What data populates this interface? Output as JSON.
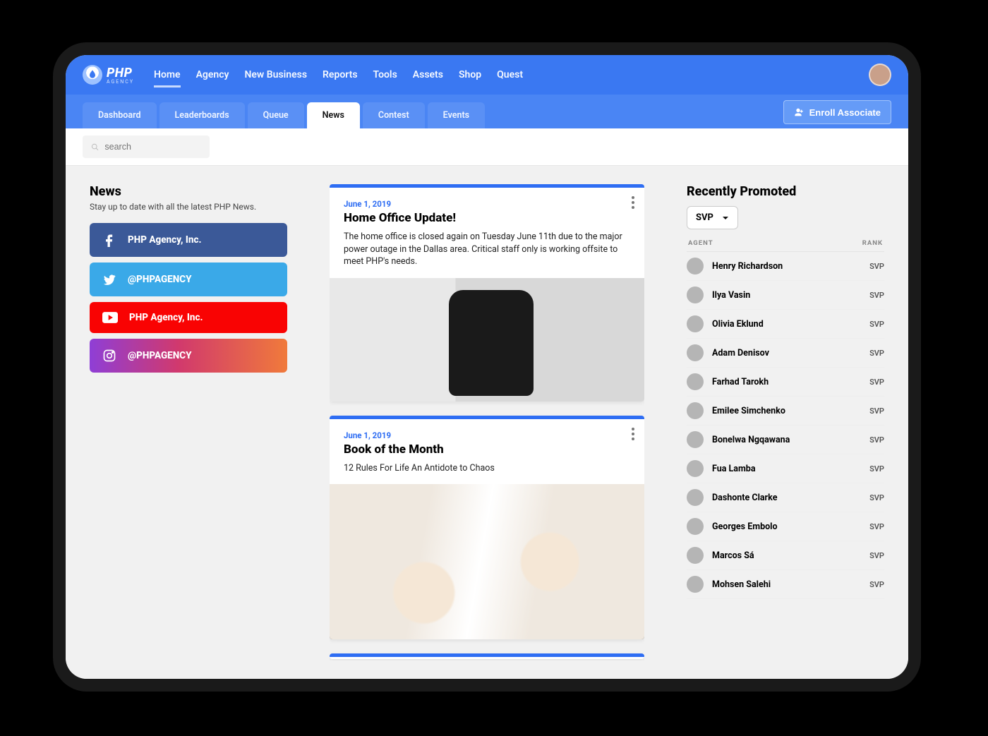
{
  "brand": {
    "name": "PHP",
    "sub": "AGENCY"
  },
  "mainnav": {
    "items": [
      "Home",
      "Agency",
      "New Business",
      "Reports",
      "Tools",
      "Assets",
      "Shop",
      "Quest"
    ],
    "active": 0
  },
  "subnav": {
    "items": [
      "Dashboard",
      "Leaderboards",
      "Queue",
      "News",
      "Contest",
      "Events"
    ],
    "active": 3
  },
  "enroll_label": "Enroll Associate",
  "search": {
    "placeholder": "search"
  },
  "left": {
    "heading": "News",
    "subtitle": "Stay up to date with all the latest PHP News.",
    "social": [
      {
        "network": "facebook",
        "label": "PHP Agency, Inc."
      },
      {
        "network": "twitter",
        "label": "@PHPAGENCY"
      },
      {
        "network": "youtube",
        "label": "PHP Agency, Inc."
      },
      {
        "network": "instagram",
        "label": "@PHPAGENCY"
      }
    ]
  },
  "feed": [
    {
      "date": "June 1, 2019",
      "title": "Home Office Update!",
      "desc": "The home office is closed again on Tuesday June 11th due to the major power outage in the Dallas area. Critical staff only is working offsite to meet PHP's needs."
    },
    {
      "date": "June 1, 2019",
      "title": "Book of the Month",
      "desc": "12 Rules For Life An Antidote to Chaos"
    }
  ],
  "right": {
    "heading": "Recently Promoted",
    "selected_rank": "SVP",
    "columns": {
      "agent": "AGENT",
      "rank": "RANK"
    },
    "agents": [
      {
        "name": "Henry Richardson",
        "rank": "SVP"
      },
      {
        "name": "Ilya Vasin",
        "rank": "SVP"
      },
      {
        "name": "Olivia Eklund",
        "rank": "SVP"
      },
      {
        "name": "Adam Denisov",
        "rank": "SVP"
      },
      {
        "name": "Farhad Tarokh",
        "rank": "SVP"
      },
      {
        "name": "Emilee Simchenko",
        "rank": "SVP"
      },
      {
        "name": "Bonelwa Ngqawana",
        "rank": "SVP"
      },
      {
        "name": "Fua Lamba",
        "rank": "SVP"
      },
      {
        "name": "Dashonte Clarke",
        "rank": "SVP"
      },
      {
        "name": "Georges Embolo",
        "rank": "SVP"
      },
      {
        "name": "Marcos Sá",
        "rank": "SVP"
      },
      {
        "name": "Mohsen Salehi",
        "rank": "SVP"
      }
    ]
  }
}
